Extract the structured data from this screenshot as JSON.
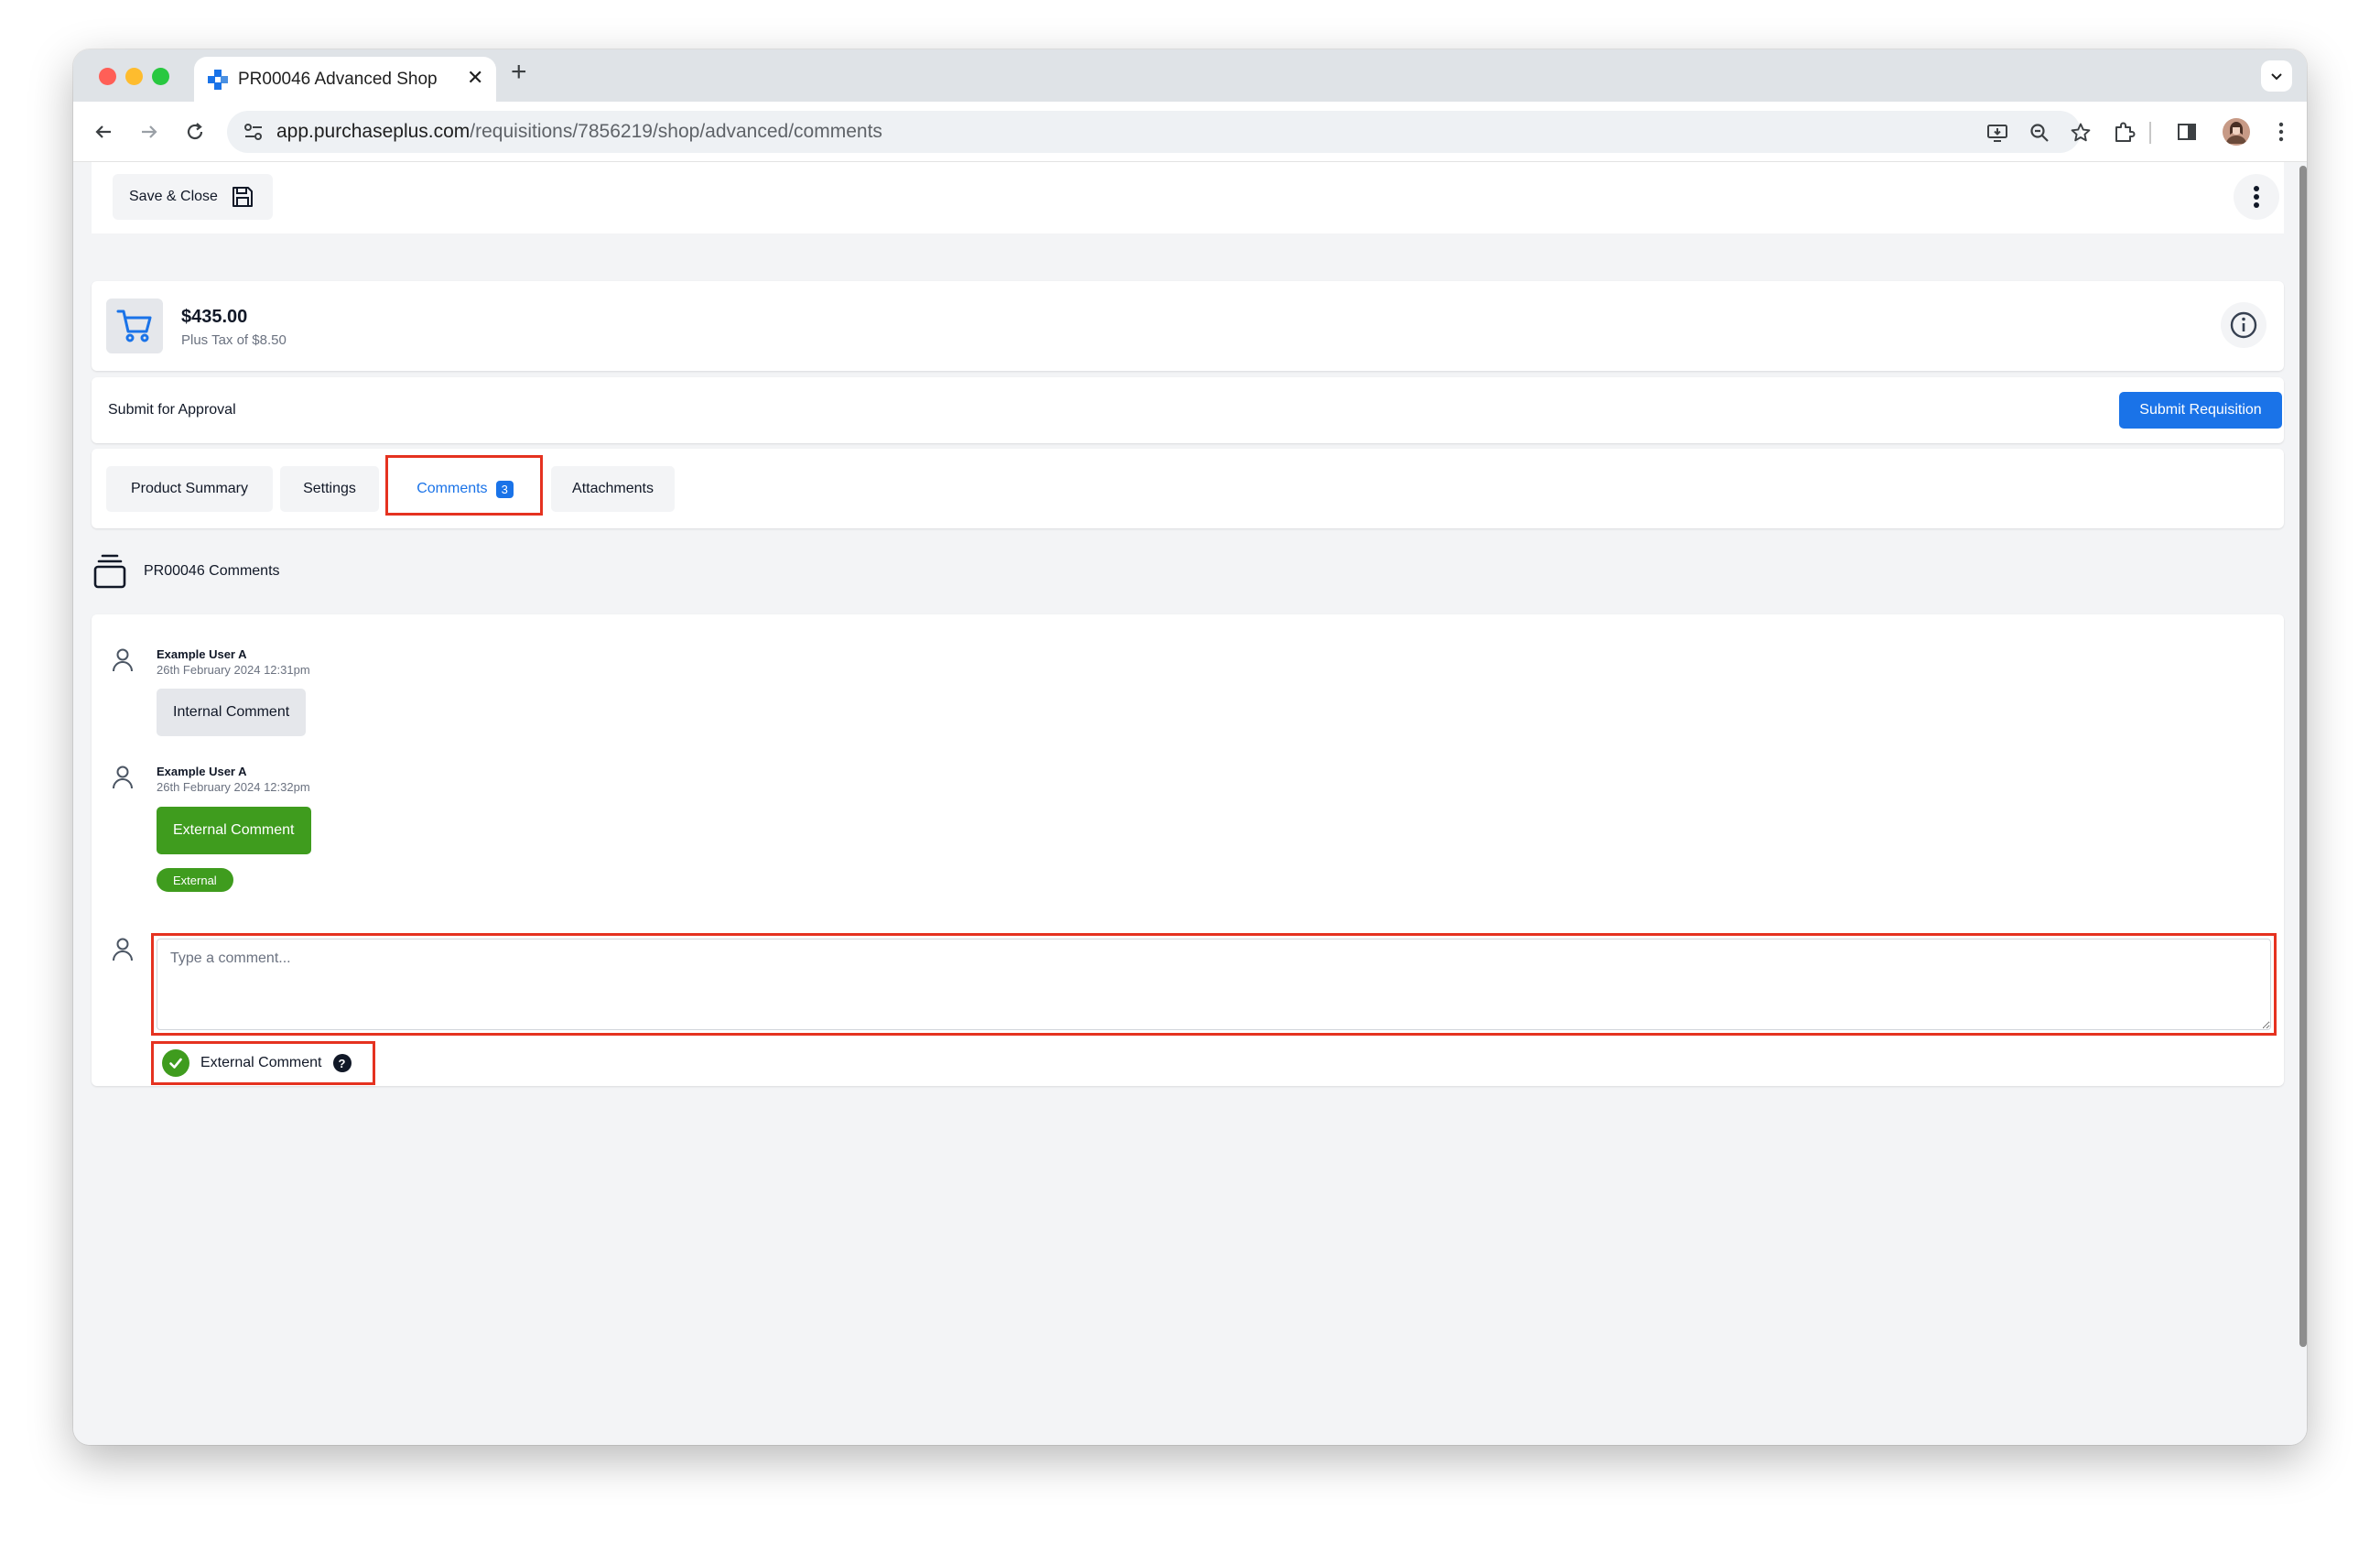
{
  "browser": {
    "tab_title": "PR00046 Advanced Shop",
    "tab_close": "✕",
    "new_tab": "+",
    "url_host": "app.purchaseplus.com",
    "url_path": "/requisitions/7856219/shop/advanced/comments"
  },
  "app_bar": {
    "save_close_label": "Save & Close"
  },
  "summary": {
    "amount": "$435.00",
    "tax": "Plus Tax of $8.50"
  },
  "approval": {
    "label": "Submit for Approval",
    "submit_label": "Submit Requisition"
  },
  "tabs": [
    {
      "label": "Product Summary"
    },
    {
      "label": "Settings"
    },
    {
      "label": "Comments",
      "badge": "3",
      "active": true
    },
    {
      "label": "Attachments"
    }
  ],
  "comments_section": {
    "title": "PR00046 Comments"
  },
  "comments": [
    {
      "author": "Example User A",
      "time": "26th February 2024 12:31pm",
      "text": "Internal Comment",
      "type": "internal"
    },
    {
      "author": "Example User A",
      "time": "26th February 2024 12:32pm",
      "text": "External Comment",
      "type": "external",
      "tag": "External"
    }
  ],
  "composer": {
    "placeholder": "Type a comment...",
    "external_label": "External Comment",
    "external_checked": true,
    "help": "?"
  },
  "colors": {
    "accent": "#1a73e8",
    "external_green": "#3f9c1e",
    "highlight_red": "#e53220"
  }
}
